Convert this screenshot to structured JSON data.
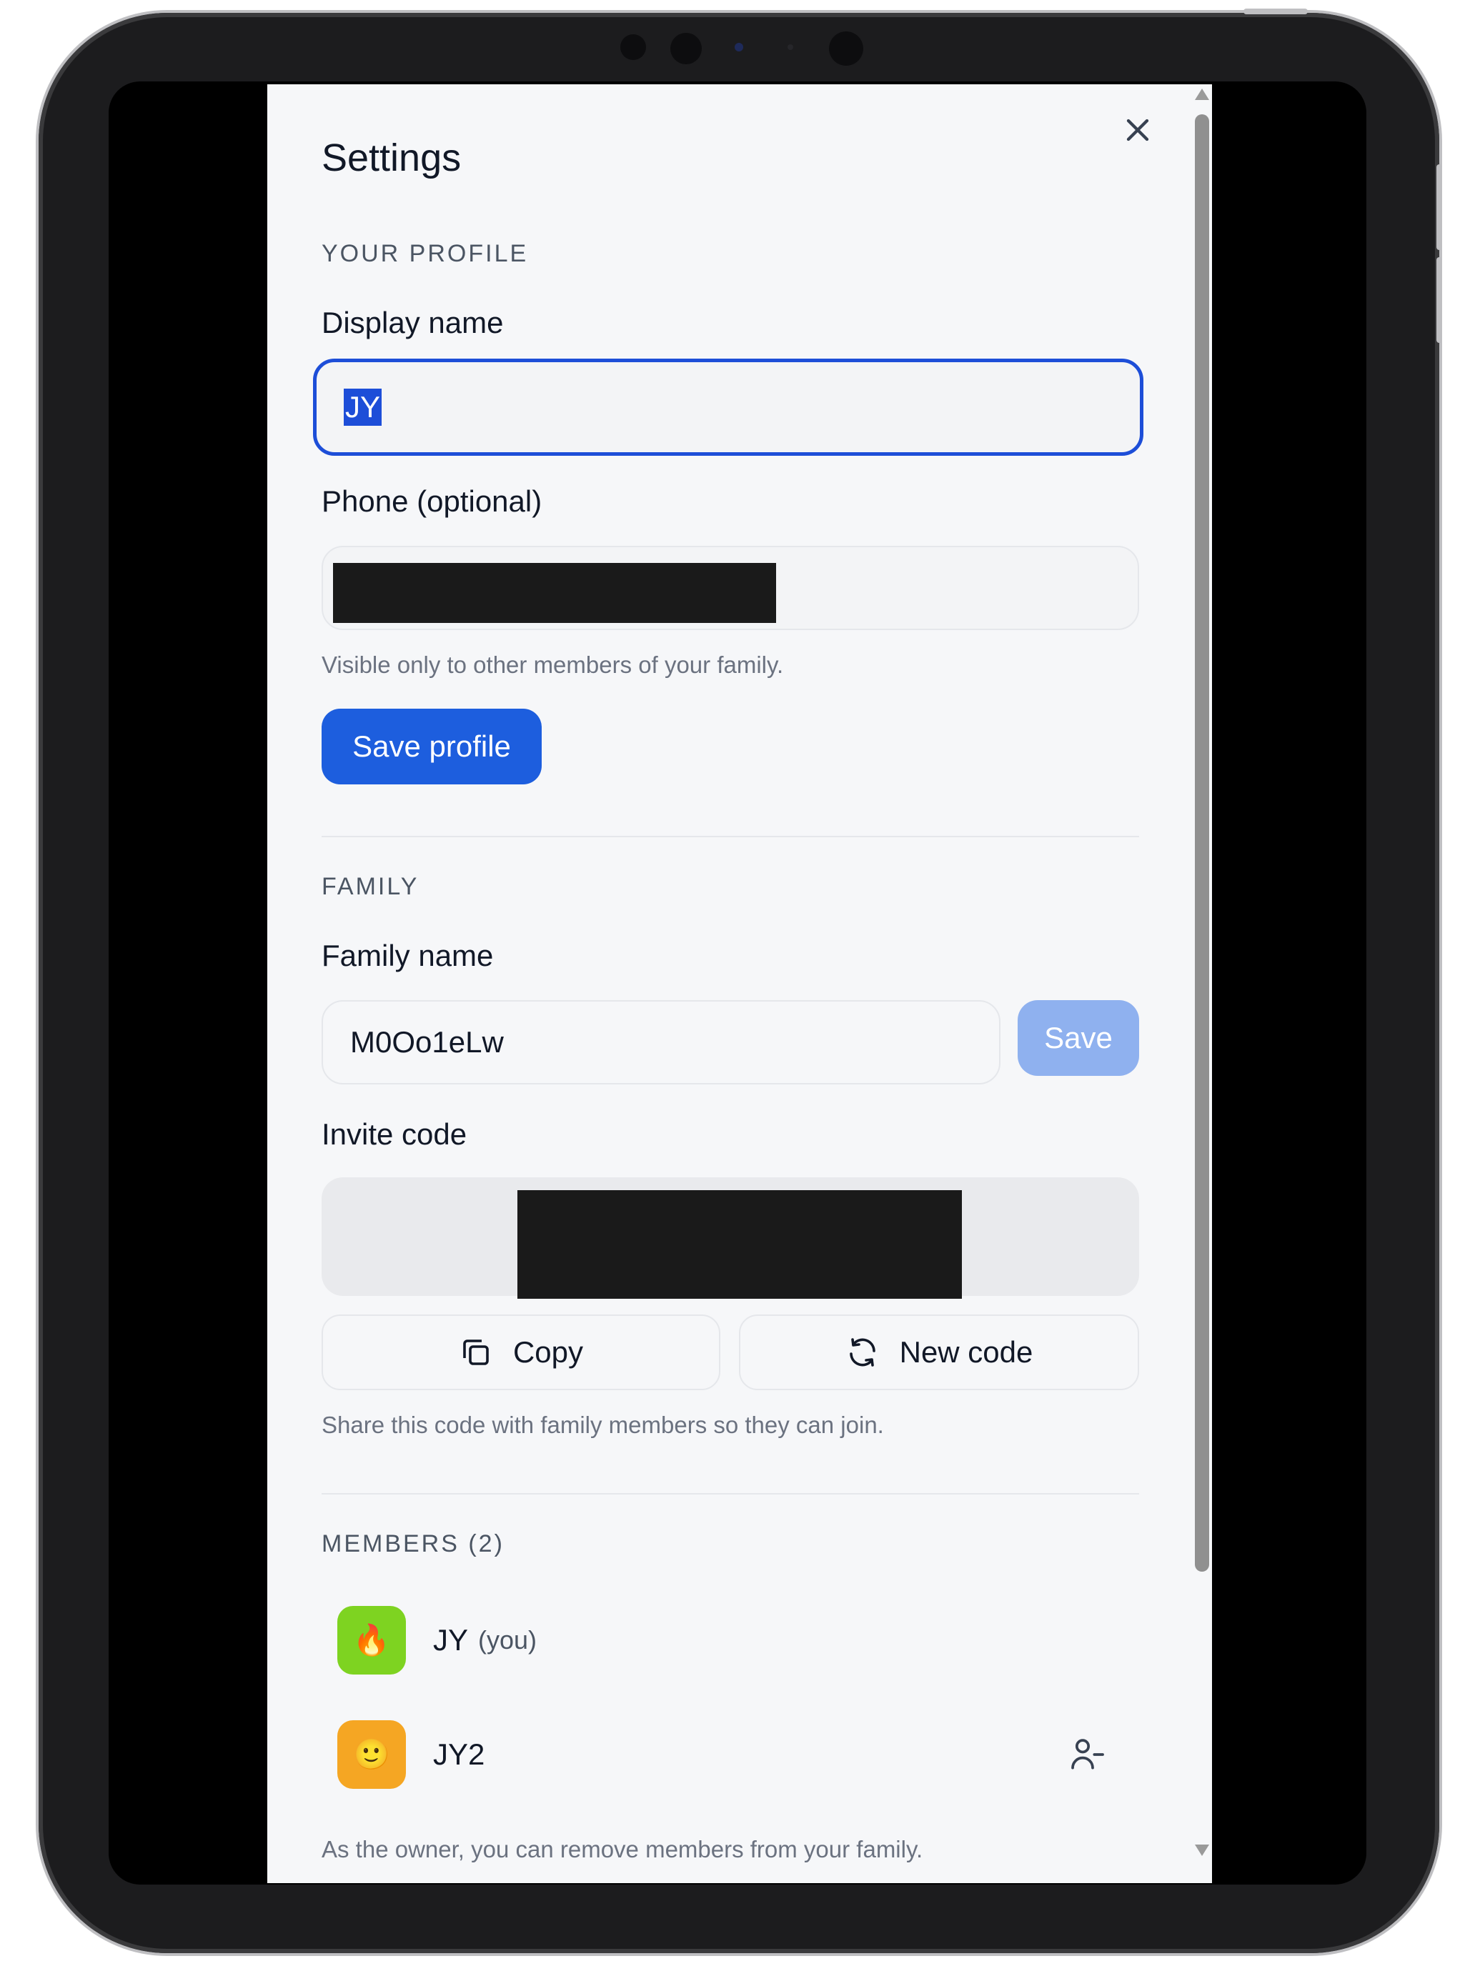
{
  "settings": {
    "title": "Settings",
    "close_icon": "close-icon"
  },
  "profile": {
    "section_label": "YOUR PROFILE",
    "display_name_label": "Display name",
    "display_name_value": "JY",
    "phone_label": "Phone (optional)",
    "phone_helper": "Visible only to other members of your family.",
    "save_label": "Save profile"
  },
  "family": {
    "section_label": "FAMILY",
    "family_name_label": "Family name",
    "family_name_value": "M0Oo1eLw",
    "save_label": "Save",
    "invite_label": "Invite code",
    "copy_label": "Copy",
    "new_code_label": "New code",
    "invite_helper": "Share this code with family members so they can join."
  },
  "members": {
    "section_label": "MEMBERS (2)",
    "list": [
      {
        "name": "JY",
        "tag": "(you)",
        "avatar_emoji": "🔥",
        "avatar_color": "#7ed321"
      },
      {
        "name": "JY2",
        "tag": "",
        "avatar_emoji": "🙂",
        "avatar_color": "#f5a623"
      }
    ],
    "owner_helper": "As the owner, you can remove members from your family."
  },
  "colors": {
    "primary": "#1d5ede",
    "primary_disabled": "#8fb1ef",
    "focus_ring": "#1d4ed8"
  }
}
